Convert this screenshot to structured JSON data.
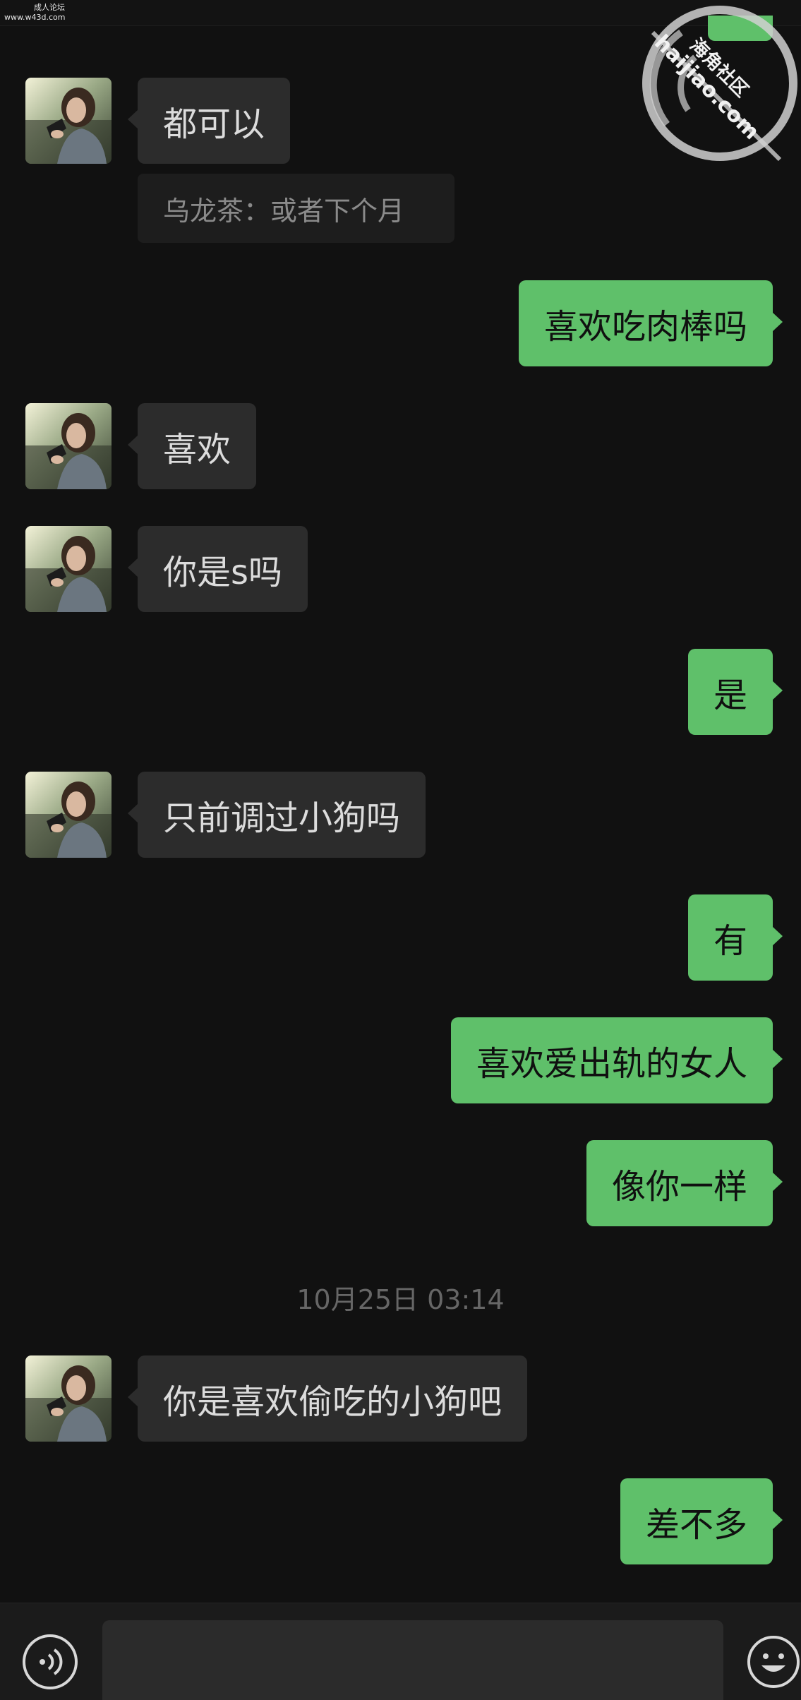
{
  "top_overlay": {
    "site_line1": "成人论坛",
    "site_line2": "www.w43d.com"
  },
  "watermark": {
    "chinese": "海角社区",
    "url": "haijiao.com"
  },
  "messages": [
    {
      "direction": "in",
      "text": "都可以",
      "quote": "乌龙茶：或者下个月"
    },
    {
      "direction": "out",
      "text": "喜欢吃肉棒吗"
    },
    {
      "direction": "in",
      "text": "喜欢"
    },
    {
      "direction": "in",
      "text": "你是s吗"
    },
    {
      "direction": "out",
      "text": "是"
    },
    {
      "direction": "in",
      "text": "只前调过小狗吗"
    },
    {
      "direction": "out",
      "text": "有"
    },
    {
      "direction": "out",
      "text": "喜欢爱出轨的女人"
    },
    {
      "direction": "out",
      "text": "像你一样"
    },
    {
      "direction": "in",
      "text": "你是喜欢偷吃的小狗吧"
    },
    {
      "direction": "out",
      "text": "差不多"
    }
  ],
  "timestamp": "10月25日 03:14",
  "input_bar": {
    "voice_icon": "voice-icon",
    "emoji_icon": "emoji-icon",
    "text_value": ""
  },
  "colors": {
    "background": "#111111",
    "incoming_bubble": "#2c2c2c",
    "outgoing_bubble": "#5fc06a",
    "timestamp_text": "#666666"
  }
}
